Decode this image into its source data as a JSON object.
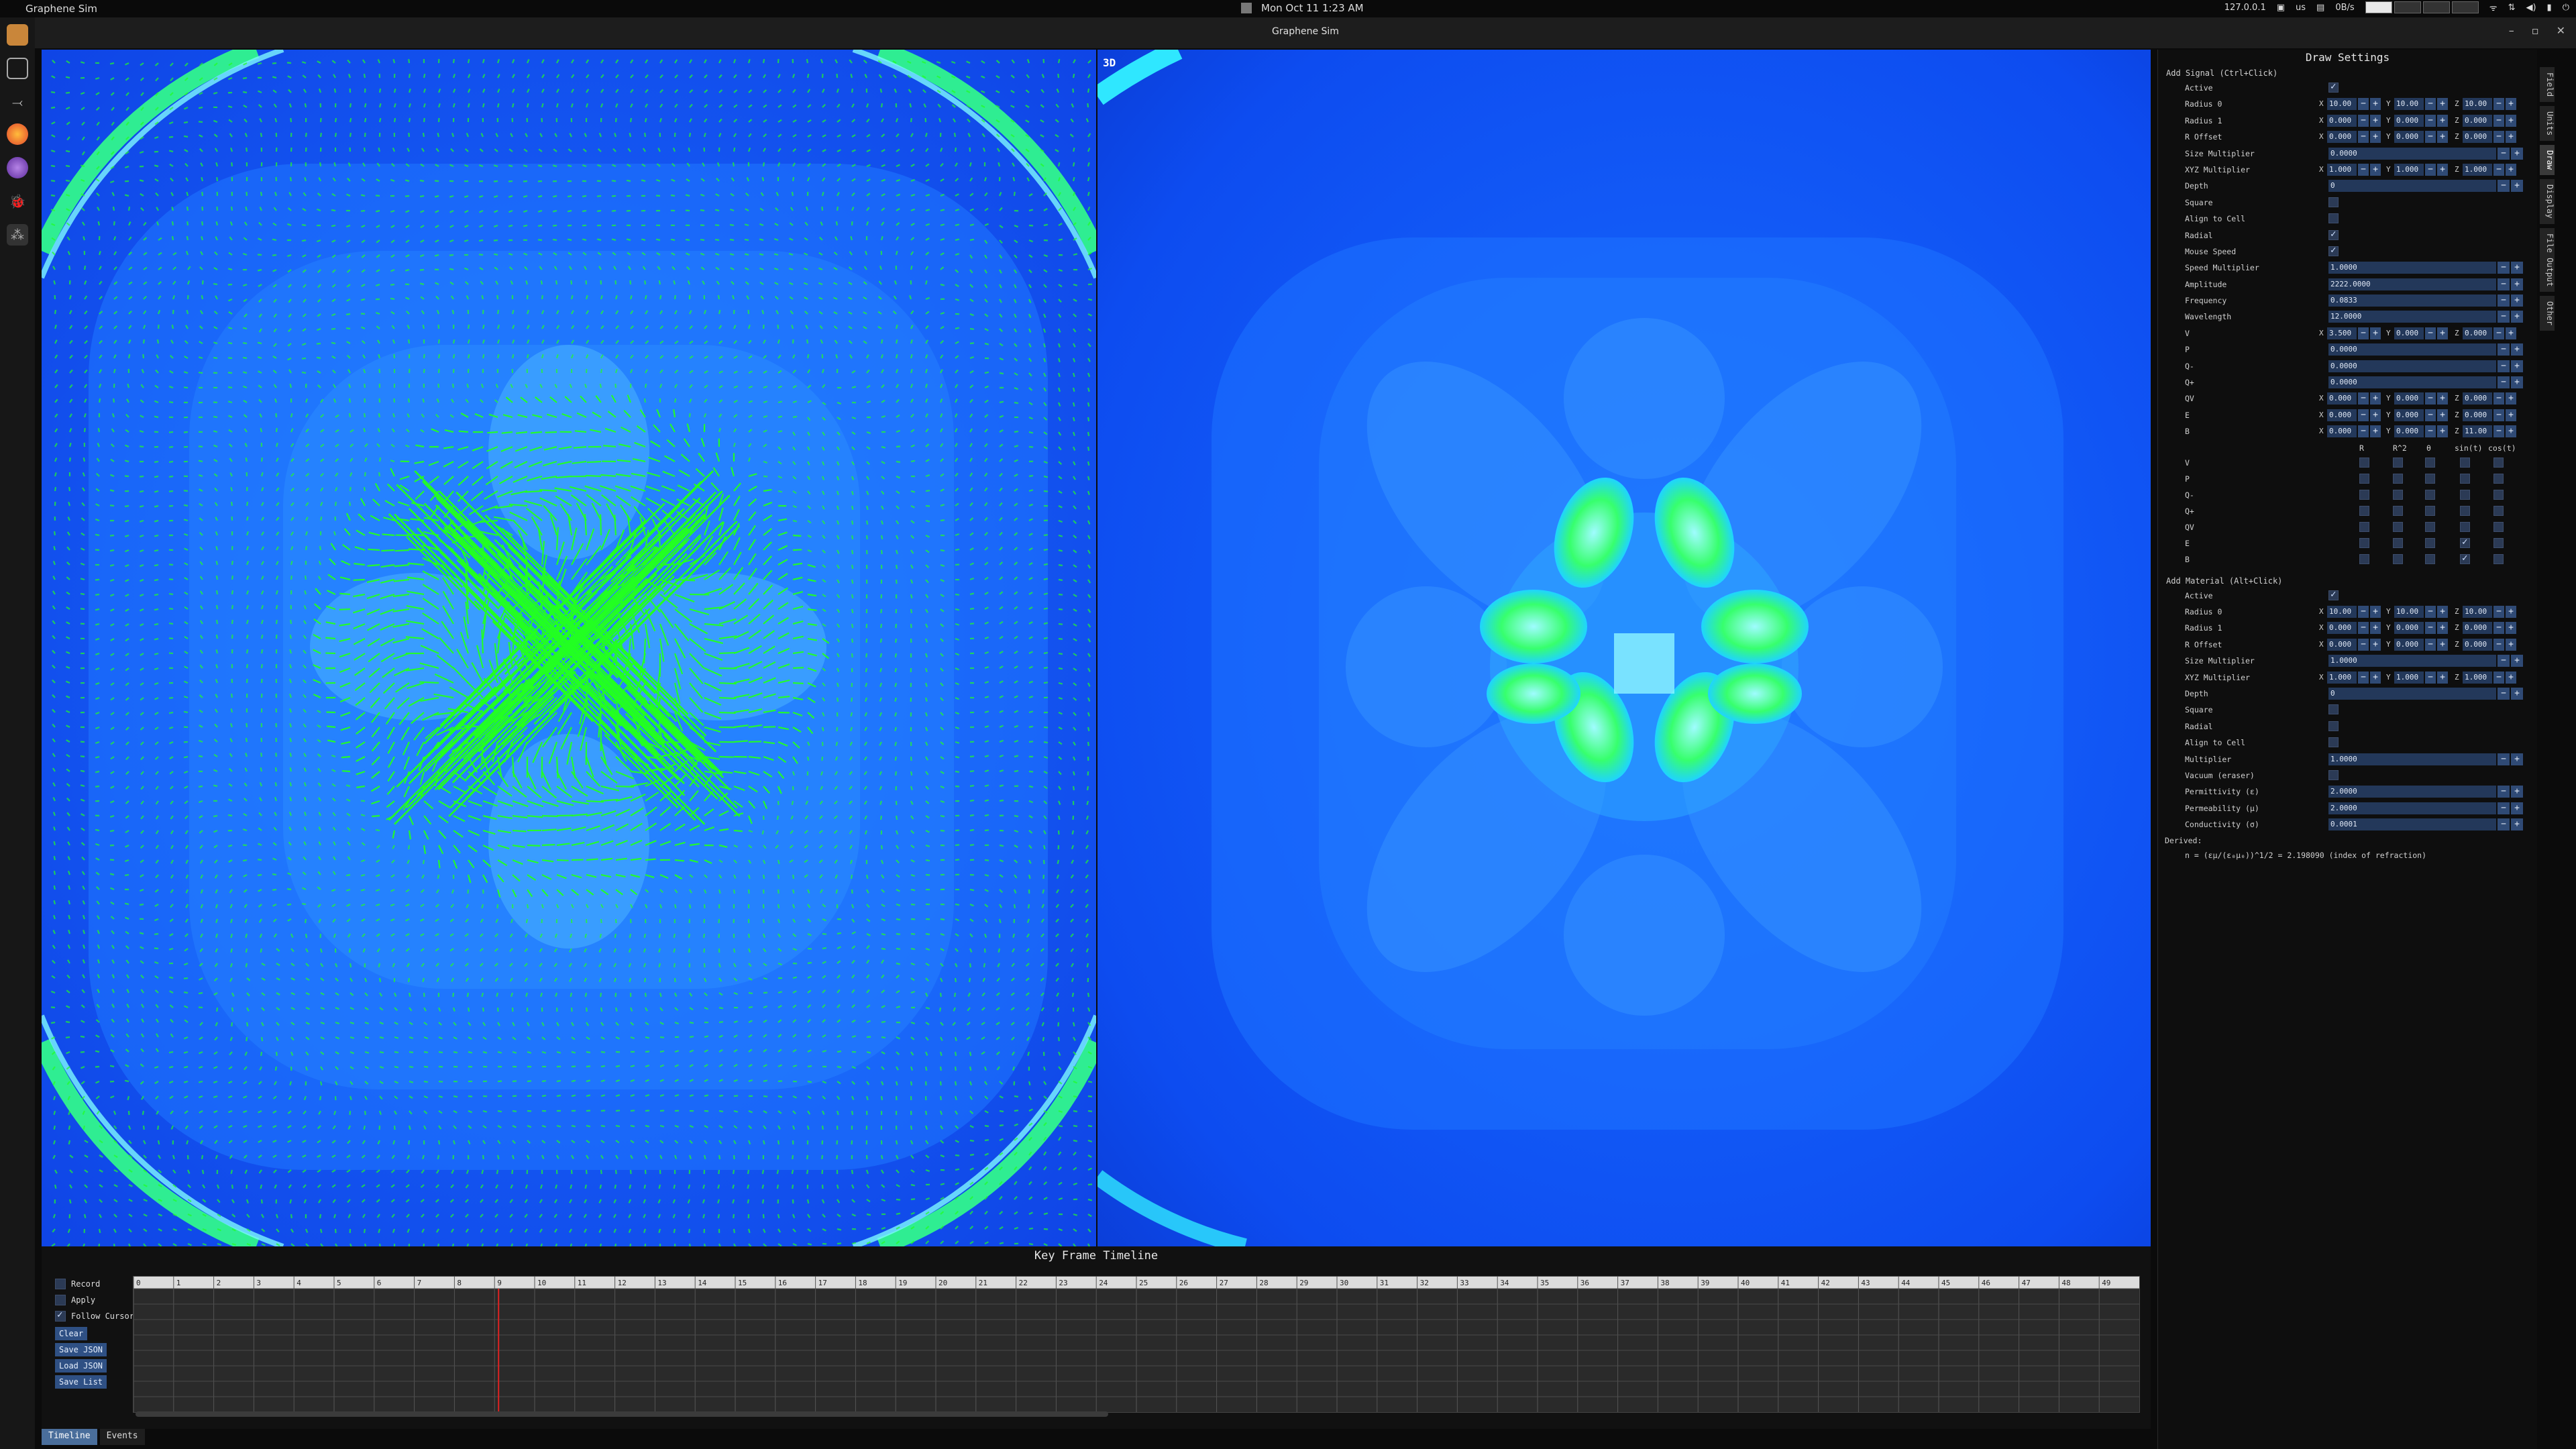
{
  "topbar": {
    "app_name": "Graphene Sim",
    "datetime": "Mon Oct 11   1:23 AM",
    "ip": "127.0.0.1",
    "keyboard": "us",
    "net_rate": "0B/s"
  },
  "window": {
    "title": "Graphene Sim"
  },
  "views": {
    "label_3d": "3D",
    "colors": {
      "field": "#1560f5",
      "vector": "#22ff22",
      "hot": "#3cff66"
    }
  },
  "timeline": {
    "title": "Key Frame Timeline",
    "record_label": "Record",
    "apply_label": "Apply",
    "follow_cursor_label": "Follow Cursor",
    "clear_label": "Clear",
    "save_json_label": "Save JSON",
    "load_json_label": "Load JSON",
    "save_list_label": "Save List",
    "frame_numbers": [
      "0",
      "1",
      "2",
      "3",
      "4",
      "5",
      "6",
      "7",
      "8",
      "9",
      "10",
      "11",
      "12",
      "13",
      "14",
      "15",
      "16",
      "17",
      "18",
      "19",
      "20",
      "21",
      "22",
      "23",
      "24",
      "25",
      "26",
      "27",
      "28",
      "29",
      "30",
      "31",
      "32",
      "33",
      "34",
      "35",
      "36",
      "37",
      "38",
      "39",
      "40",
      "41",
      "42",
      "43",
      "44",
      "45",
      "46",
      "47",
      "48",
      "49"
    ],
    "current_frame": 9
  },
  "bottom_tabs": [
    {
      "label": "Timeline",
      "active": true
    },
    {
      "label": "Events",
      "active": false
    }
  ],
  "panel": {
    "title": "Draw Settings",
    "signal": {
      "title": "Add Signal (Ctrl+Click)",
      "active_label": "Active",
      "radius0_label": "Radius 0",
      "radius0": [
        "10.00",
        "10.00",
        "10.00"
      ],
      "radius1_label": "Radius 1",
      "radius1": [
        "0.000",
        "0.000",
        "0.000"
      ],
      "roffset_label": "R Offset",
      "roffset": [
        "0.000",
        "0.000",
        "0.000"
      ],
      "size_mult_label": "Size Multiplier",
      "size_mult": "0.0000",
      "xyz_mult_label": "XYZ Multiplier",
      "xyz_mult": [
        "1.000",
        "1.000",
        "1.000"
      ],
      "depth_label": "Depth",
      "depth": "0",
      "square_label": "Square",
      "align_label": "Align to Cell",
      "radial_label": "Radial",
      "mouse_speed_label": "Mouse Speed",
      "speed_mult_label": "Speed Multiplier",
      "speed_mult": "1.0000",
      "amplitude_label": "Amplitude",
      "amplitude": "2222.0000",
      "frequency_label": "Frequency",
      "frequency": "0.0833",
      "wavelength_label": "Wavelength",
      "wavelength": "12.0000",
      "v_label": "V",
      "v": [
        "3.500",
        "0.000",
        "0.000"
      ],
      "p_label": "P",
      "p": "0.0000",
      "qminus_label": "Q-",
      "qminus": "0.0000",
      "qplus_label": "Q+",
      "qplus": "0.0000",
      "qv_label": "QV",
      "qv": [
        "0.000",
        "0.000",
        "0.000"
      ],
      "e_label": "E",
      "e": [
        "0.000",
        "0.000",
        "0.000"
      ],
      "b_label": "B",
      "b": [
        "0.000",
        "0.000",
        "11.00"
      ]
    },
    "modifiers": {
      "headers": [
        "R",
        "R^2",
        "θ",
        "sin(t)",
        "cos(t)"
      ],
      "rows": [
        {
          "label": "V",
          "checks": [
            false,
            false,
            false,
            false,
            false
          ]
        },
        {
          "label": "P",
          "checks": [
            false,
            false,
            false,
            false,
            false
          ]
        },
        {
          "label": "Q-",
          "checks": [
            false,
            false,
            false,
            false,
            false
          ]
        },
        {
          "label": "Q+",
          "checks": [
            false,
            false,
            false,
            false,
            false
          ]
        },
        {
          "label": "QV",
          "checks": [
            false,
            false,
            false,
            false,
            false
          ]
        },
        {
          "label": "E",
          "checks": [
            false,
            false,
            false,
            true,
            false
          ]
        },
        {
          "label": "B",
          "checks": [
            false,
            false,
            false,
            true,
            false
          ]
        }
      ]
    },
    "material": {
      "title": "Add Material (Alt+Click)",
      "active_label": "Active",
      "radius0_label": "Radius 0",
      "radius0": [
        "10.00",
        "10.00",
        "10.00"
      ],
      "radius1_label": "Radius 1",
      "radius1": [
        "0.000",
        "0.000",
        "0.000"
      ],
      "roffset_label": "R Offset",
      "roffset": [
        "0.000",
        "0.000",
        "0.000"
      ],
      "size_mult_label": "Size Multiplier",
      "size_mult": "1.0000",
      "xyz_mult_label": "XYZ Multiplier",
      "xyz_mult": [
        "1.000",
        "1.000",
        "1.000"
      ],
      "depth_label": "Depth",
      "depth": "0",
      "square_label": "Square",
      "radial_label": "Radial",
      "align_label": "Align to Cell",
      "multiplier_label": "Multiplier",
      "multiplier": "1.0000",
      "vacuum_label": "Vacuum (eraser)",
      "permittivity_label": "Permittivity (ε)",
      "permittivity": "2.0000",
      "permeability_label": "Permeability (μ)",
      "permeability": "2.0000",
      "conductivity_label": "Conductivity (σ)",
      "conductivity": "0.0001",
      "derived_label": "Derived:",
      "derived_formula": "n = (εμ/(ε₀μ₀))^1/2  = 2.198090  (index of refraction)"
    }
  },
  "vertical_tabs": [
    "Field",
    "Units",
    "Draw",
    "Display",
    "File Output",
    "Other"
  ],
  "active_vertical_tab": "Draw"
}
